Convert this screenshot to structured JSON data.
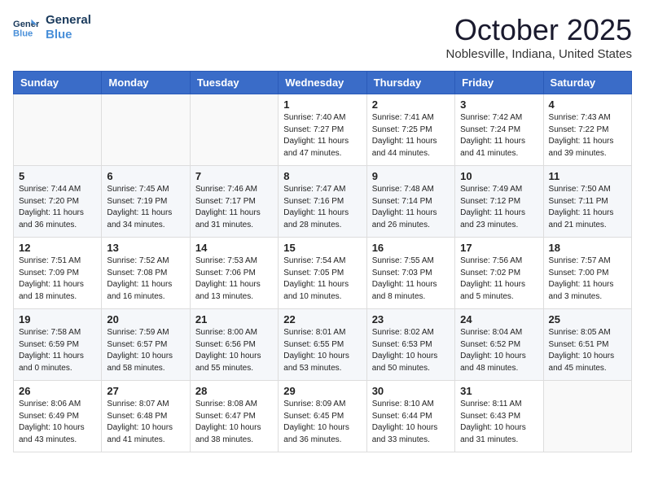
{
  "logo": {
    "line1": "General",
    "line2": "Blue"
  },
  "title": "October 2025",
  "location": "Noblesville, Indiana, United States",
  "days_of_week": [
    "Sunday",
    "Monday",
    "Tuesday",
    "Wednesday",
    "Thursday",
    "Friday",
    "Saturday"
  ],
  "weeks": [
    [
      {
        "num": "",
        "info": ""
      },
      {
        "num": "",
        "info": ""
      },
      {
        "num": "",
        "info": ""
      },
      {
        "num": "1",
        "info": "Sunrise: 7:40 AM\nSunset: 7:27 PM\nDaylight: 11 hours\nand 47 minutes."
      },
      {
        "num": "2",
        "info": "Sunrise: 7:41 AM\nSunset: 7:25 PM\nDaylight: 11 hours\nand 44 minutes."
      },
      {
        "num": "3",
        "info": "Sunrise: 7:42 AM\nSunset: 7:24 PM\nDaylight: 11 hours\nand 41 minutes."
      },
      {
        "num": "4",
        "info": "Sunrise: 7:43 AM\nSunset: 7:22 PM\nDaylight: 11 hours\nand 39 minutes."
      }
    ],
    [
      {
        "num": "5",
        "info": "Sunrise: 7:44 AM\nSunset: 7:20 PM\nDaylight: 11 hours\nand 36 minutes."
      },
      {
        "num": "6",
        "info": "Sunrise: 7:45 AM\nSunset: 7:19 PM\nDaylight: 11 hours\nand 34 minutes."
      },
      {
        "num": "7",
        "info": "Sunrise: 7:46 AM\nSunset: 7:17 PM\nDaylight: 11 hours\nand 31 minutes."
      },
      {
        "num": "8",
        "info": "Sunrise: 7:47 AM\nSunset: 7:16 PM\nDaylight: 11 hours\nand 28 minutes."
      },
      {
        "num": "9",
        "info": "Sunrise: 7:48 AM\nSunset: 7:14 PM\nDaylight: 11 hours\nand 26 minutes."
      },
      {
        "num": "10",
        "info": "Sunrise: 7:49 AM\nSunset: 7:12 PM\nDaylight: 11 hours\nand 23 minutes."
      },
      {
        "num": "11",
        "info": "Sunrise: 7:50 AM\nSunset: 7:11 PM\nDaylight: 11 hours\nand 21 minutes."
      }
    ],
    [
      {
        "num": "12",
        "info": "Sunrise: 7:51 AM\nSunset: 7:09 PM\nDaylight: 11 hours\nand 18 minutes."
      },
      {
        "num": "13",
        "info": "Sunrise: 7:52 AM\nSunset: 7:08 PM\nDaylight: 11 hours\nand 16 minutes."
      },
      {
        "num": "14",
        "info": "Sunrise: 7:53 AM\nSunset: 7:06 PM\nDaylight: 11 hours\nand 13 minutes."
      },
      {
        "num": "15",
        "info": "Sunrise: 7:54 AM\nSunset: 7:05 PM\nDaylight: 11 hours\nand 10 minutes."
      },
      {
        "num": "16",
        "info": "Sunrise: 7:55 AM\nSunset: 7:03 PM\nDaylight: 11 hours\nand 8 minutes."
      },
      {
        "num": "17",
        "info": "Sunrise: 7:56 AM\nSunset: 7:02 PM\nDaylight: 11 hours\nand 5 minutes."
      },
      {
        "num": "18",
        "info": "Sunrise: 7:57 AM\nSunset: 7:00 PM\nDaylight: 11 hours\nand 3 minutes."
      }
    ],
    [
      {
        "num": "19",
        "info": "Sunrise: 7:58 AM\nSunset: 6:59 PM\nDaylight: 11 hours\nand 0 minutes."
      },
      {
        "num": "20",
        "info": "Sunrise: 7:59 AM\nSunset: 6:57 PM\nDaylight: 10 hours\nand 58 minutes."
      },
      {
        "num": "21",
        "info": "Sunrise: 8:00 AM\nSunset: 6:56 PM\nDaylight: 10 hours\nand 55 minutes."
      },
      {
        "num": "22",
        "info": "Sunrise: 8:01 AM\nSunset: 6:55 PM\nDaylight: 10 hours\nand 53 minutes."
      },
      {
        "num": "23",
        "info": "Sunrise: 8:02 AM\nSunset: 6:53 PM\nDaylight: 10 hours\nand 50 minutes."
      },
      {
        "num": "24",
        "info": "Sunrise: 8:04 AM\nSunset: 6:52 PM\nDaylight: 10 hours\nand 48 minutes."
      },
      {
        "num": "25",
        "info": "Sunrise: 8:05 AM\nSunset: 6:51 PM\nDaylight: 10 hours\nand 45 minutes."
      }
    ],
    [
      {
        "num": "26",
        "info": "Sunrise: 8:06 AM\nSunset: 6:49 PM\nDaylight: 10 hours\nand 43 minutes."
      },
      {
        "num": "27",
        "info": "Sunrise: 8:07 AM\nSunset: 6:48 PM\nDaylight: 10 hours\nand 41 minutes."
      },
      {
        "num": "28",
        "info": "Sunrise: 8:08 AM\nSunset: 6:47 PM\nDaylight: 10 hours\nand 38 minutes."
      },
      {
        "num": "29",
        "info": "Sunrise: 8:09 AM\nSunset: 6:45 PM\nDaylight: 10 hours\nand 36 minutes."
      },
      {
        "num": "30",
        "info": "Sunrise: 8:10 AM\nSunset: 6:44 PM\nDaylight: 10 hours\nand 33 minutes."
      },
      {
        "num": "31",
        "info": "Sunrise: 8:11 AM\nSunset: 6:43 PM\nDaylight: 10 hours\nand 31 minutes."
      },
      {
        "num": "",
        "info": ""
      }
    ]
  ]
}
